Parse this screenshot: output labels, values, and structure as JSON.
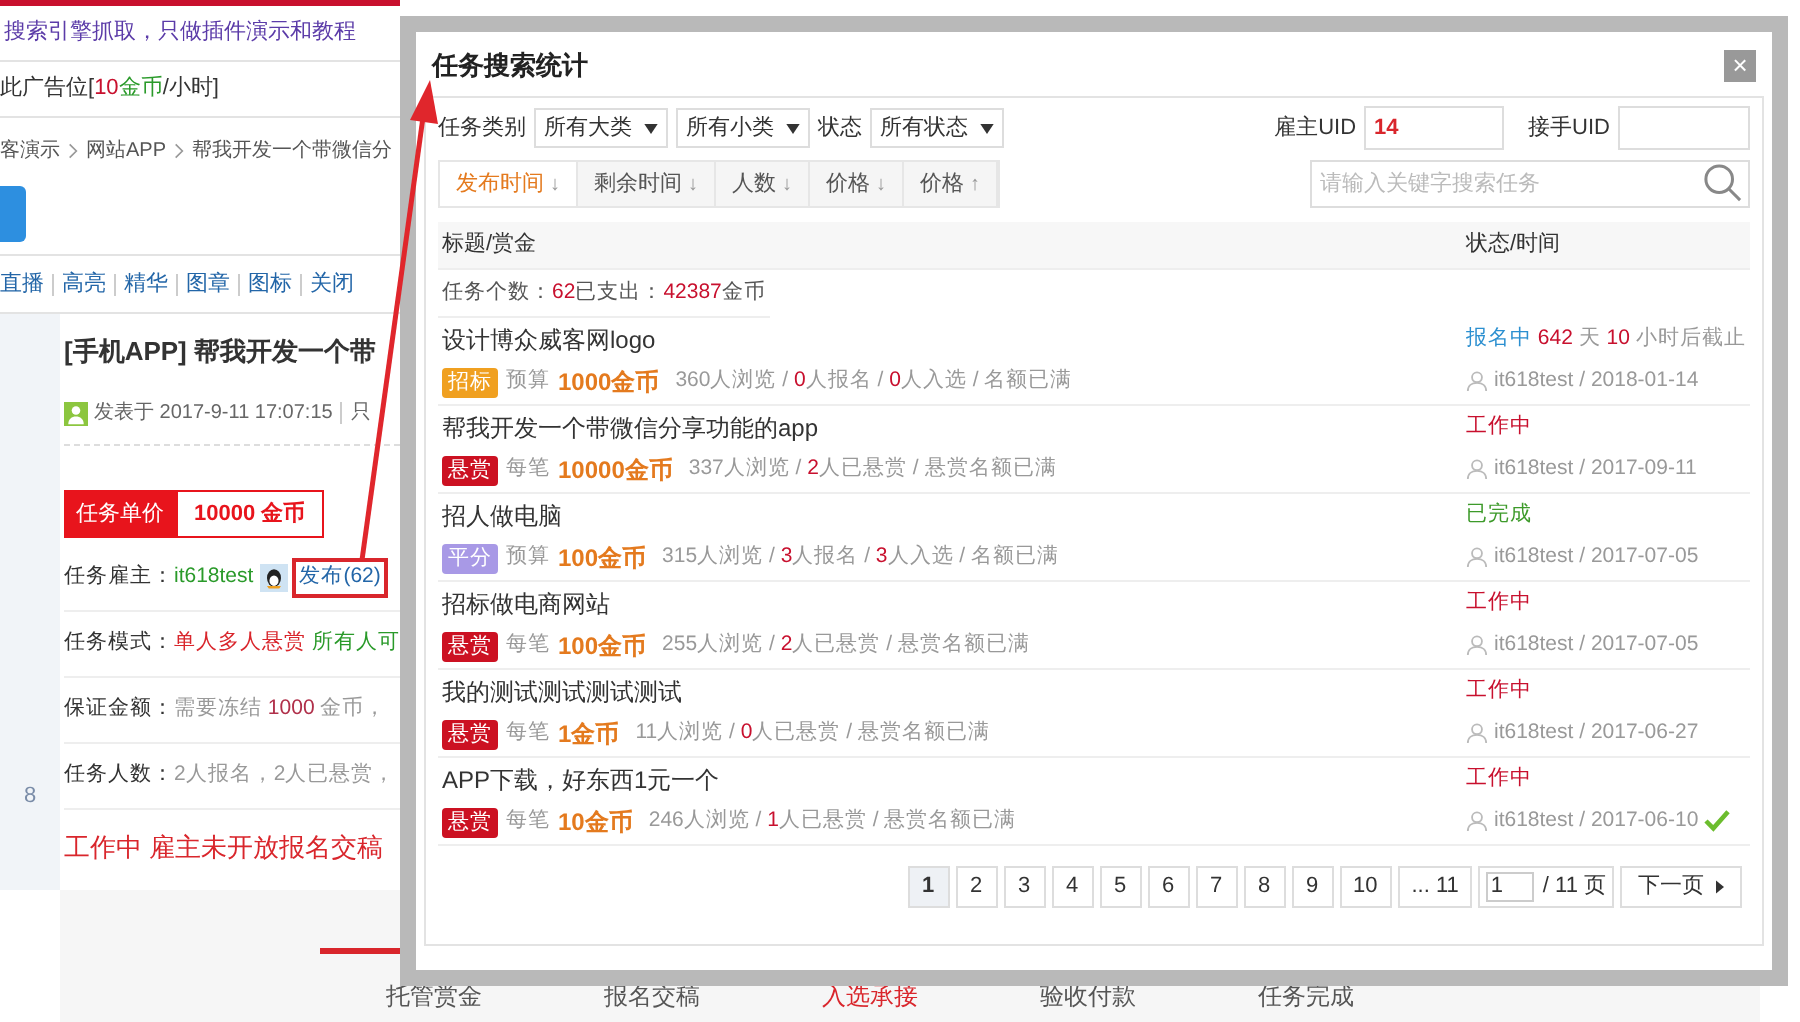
{
  "page": {
    "notice": "搜索引擎抓取，只做插件演示和教程",
    "ad": {
      "before": "此广告位[",
      "price": "10",
      "unit": "金币",
      "after": "/小时]"
    },
    "breadcrumb": [
      "客演示",
      "网站APP",
      "帮我开发一个带微信分"
    ],
    "tools": [
      "直播",
      "高亮",
      "精华",
      "图章",
      "图标",
      "关闭"
    ],
    "title": "[手机APP] 帮我开发一个带",
    "posted": "发表于 2017-9-11 17:07:15",
    "posted_extra": "只",
    "unit_price": {
      "label": "任务单价",
      "value": "10000 金币"
    },
    "employer": {
      "label": "任务雇主：",
      "name": "it618test",
      "link": "发布(62)"
    },
    "mode": {
      "label": "任务模式：",
      "value": "单人多人悬赏",
      "extra": "所有人可"
    },
    "deposit": {
      "label": "保证金额：",
      "text": "需要冻结 ",
      "amount": "1000",
      "rest": " 金币，"
    },
    "people": {
      "label": "任务人数：",
      "text": "2人报名，2人已悬赏，"
    },
    "status_line": "工作中 雇主未开放报名交稿",
    "side_number": "8",
    "steps": [
      {
        "label": "托管赏金",
        "selected": false
      },
      {
        "label": "报名交稿",
        "selected": false
      },
      {
        "label": "入选承接",
        "selected": true
      },
      {
        "label": "验收付款",
        "selected": false
      },
      {
        "label": "任务完成",
        "selected": false
      }
    ]
  },
  "dialog": {
    "title": "任务搜索统计",
    "close": "×",
    "filters": {
      "category_label": "任务类别",
      "selects": [
        "所有大类",
        "所有小类"
      ],
      "status_label": "状态",
      "status_select": "所有状态",
      "employer_uid_label": "雇主UID",
      "employer_uid": "14",
      "taker_uid_label": "接手UID"
    },
    "sorts": [
      {
        "label": "发布时间",
        "arrow": "↓",
        "selected": true
      },
      {
        "label": "剩余时间",
        "arrow": "↓",
        "selected": false
      },
      {
        "label": "人数",
        "arrow": "↓",
        "selected": false
      },
      {
        "label": "价格",
        "arrow": "↓",
        "selected": false
      },
      {
        "label": "价格",
        "arrow": "↑",
        "selected": false
      }
    ],
    "search": {
      "placeholder": "请输入关键字搜索任务"
    },
    "columns": [
      "标题/赏金",
      "状态/时间"
    ],
    "summary": {
      "count_label": "任务个数：",
      "count": "62",
      "spent_label": " 已支出：",
      "spent": "42387",
      "unit": " 金币"
    },
    "rows": [
      {
        "title": "设计博众威客网logo",
        "tag": {
          "text": "招标",
          "color": "#f0a020"
        },
        "price_label": "预算",
        "amount": "1000金币",
        "stats": [
          {
            "text": "360人浏览 / ",
            "hl": false
          },
          {
            "text": "0",
            "hl": true
          },
          {
            "text": "人报名 / ",
            "hl": false
          },
          {
            "text": "0",
            "hl": true
          },
          {
            "text": "人入选 / 名额已满",
            "hl": false
          }
        ],
        "status": {
          "text": "报名中",
          "color": "#2b8fd0"
        },
        "deadline": {
          "days": "642",
          "days_unit": " 天 ",
          "hours": "10",
          "hours_unit": " 小时后截止"
        },
        "user": "it618test / 2018-01-14",
        "accepted": false
      },
      {
        "title": "帮我开发一个带微信分享功能的app",
        "tag": {
          "text": "悬赏",
          "color": "#cc1122"
        },
        "price_label": "每笔",
        "amount": "10000金币",
        "stats": [
          {
            "text": "337人浏览 / ",
            "hl": false
          },
          {
            "text": "2",
            "hl": true
          },
          {
            "text": "人已悬赏 / 悬赏名额已满",
            "hl": false
          }
        ],
        "status": {
          "text": "工作中",
          "color": "#c8102e"
        },
        "user": "it618test / 2017-09-11",
        "accepted": false
      },
      {
        "title": "招人做电脑",
        "tag": {
          "text": "平分",
          "color": "#a899e6"
        },
        "price_label": "预算",
        "amount": "100金币",
        "stats": [
          {
            "text": "315人浏览 / ",
            "hl": false
          },
          {
            "text": "3",
            "hl": true
          },
          {
            "text": "人报名 / ",
            "hl": false
          },
          {
            "text": "3",
            "hl": true
          },
          {
            "text": "人入选 / 名额已满",
            "hl": false
          }
        ],
        "status": {
          "text": "已完成",
          "color": "#3d9a2a"
        },
        "user": "it618test / 2017-07-05",
        "accepted": false
      },
      {
        "title": "招标做电商网站",
        "tag": {
          "text": "悬赏",
          "color": "#cc1122"
        },
        "price_label": "每笔",
        "amount": "100金币",
        "stats": [
          {
            "text": "255人浏览 / ",
            "hl": false
          },
          {
            "text": "2",
            "hl": true
          },
          {
            "text": "人已悬赏 / 悬赏名额已满",
            "hl": false
          }
        ],
        "status": {
          "text": "工作中",
          "color": "#c8102e"
        },
        "user": "it618test / 2017-07-05",
        "accepted": false
      },
      {
        "title": "我的测试测试测试测试",
        "tag": {
          "text": "悬赏",
          "color": "#cc1122"
        },
        "price_label": "每笔",
        "amount": "1金币",
        "stats": [
          {
            "text": "11人浏览 / ",
            "hl": false
          },
          {
            "text": "0",
            "hl": true
          },
          {
            "text": "人已悬赏 / 悬赏名额已满",
            "hl": false
          }
        ],
        "status": {
          "text": "工作中",
          "color": "#c8102e"
        },
        "user": "it618test / 2017-06-27",
        "accepted": false
      },
      {
        "title": "APP下载，好东西1元一个",
        "tag": {
          "text": "悬赏",
          "color": "#cc1122"
        },
        "price_label": "每笔",
        "amount": "10金币",
        "stats": [
          {
            "text": "246人浏览 / ",
            "hl": false
          },
          {
            "text": "1",
            "hl": true
          },
          {
            "text": "人已悬赏 / 悬赏名额已满",
            "hl": false
          }
        ],
        "status": {
          "text": "工作中",
          "color": "#c8102e"
        },
        "user": "it618test / 2017-06-10",
        "accepted": true
      }
    ],
    "pagination": {
      "pages": [
        {
          "label": "1",
          "selected": true
        },
        {
          "label": "2",
          "selected": false
        },
        {
          "label": "3",
          "selected": false
        },
        {
          "label": "4",
          "selected": false
        },
        {
          "label": "5",
          "selected": false
        },
        {
          "label": "6",
          "selected": false
        },
        {
          "label": "7",
          "selected": false
        },
        {
          "label": "8",
          "selected": false
        },
        {
          "label": "9",
          "selected": false
        },
        {
          "label": "10",
          "selected": false
        },
        {
          "label": "... 11",
          "selected": false
        }
      ],
      "page_input": "1",
      "total": "/ 11 页",
      "next": "下一页"
    }
  }
}
